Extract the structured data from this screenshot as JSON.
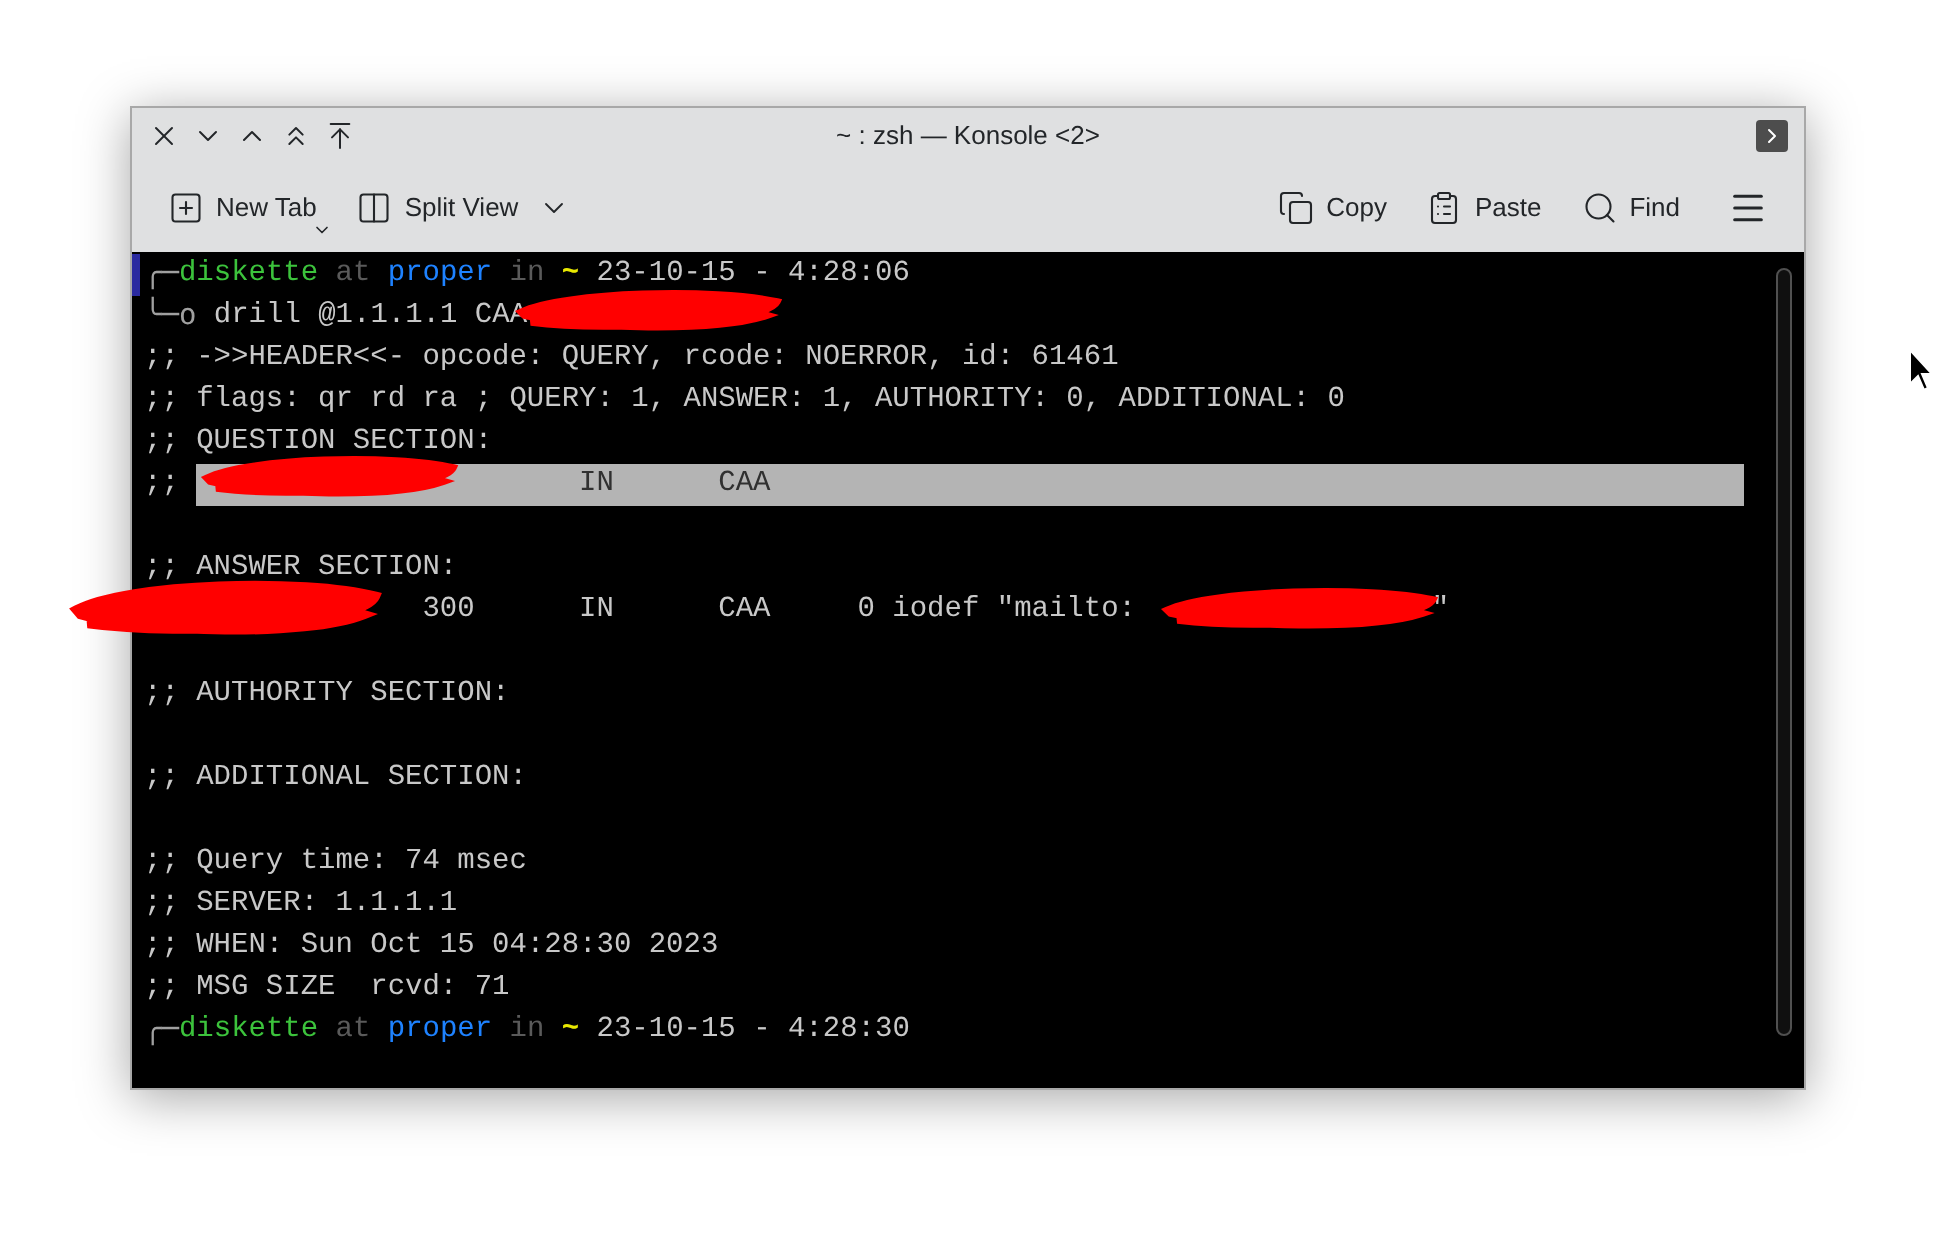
{
  "window": {
    "title": "~ : zsh — Konsole <2>"
  },
  "toolbar": {
    "left": [
      {
        "label": "New Tab",
        "kind": "newtab"
      },
      {
        "label": "Split View",
        "kind": "split"
      }
    ],
    "right": [
      {
        "label": "Copy",
        "kind": "copy"
      },
      {
        "label": "Paste",
        "kind": "paste"
      },
      {
        "label": "Find",
        "kind": "find"
      }
    ]
  },
  "terminal": {
    "lines": [
      {
        "kind": "prompt",
        "corner": "╭─",
        "user": "diskette",
        "at": "at",
        "host": "proper",
        "in": "in",
        "dir": "~",
        "time": "23-10-15 - 4:28:06",
        "active": true
      },
      {
        "kind": "command",
        "corner": "╰─o",
        "text": "drill @1.1.1.1 CAA"
      },
      {
        "kind": "output",
        "text": ";; ->>HEADER<<- opcode: QUERY, rcode: NOERROR, id: 61461"
      },
      {
        "kind": "output",
        "text": ";; flags: qr rd ra ; QUERY: 1, ANSWER: 1, AUTHORITY: 0, ADDITIONAL: 0"
      },
      {
        "kind": "output",
        "text": ";; QUESTION SECTION:"
      },
      {
        "kind": "question",
        "prefix": ";;",
        "fields": [
          "IN",
          "CAA"
        ],
        "highlighted": true
      },
      {
        "kind": "blank"
      },
      {
        "kind": "output",
        "text": ";; ANSWER SECTION:"
      },
      {
        "kind": "answer",
        "fields": [
          "300",
          "IN",
          "CAA",
          "0 iodef \"mailto:",
          "\""
        ]
      },
      {
        "kind": "blank"
      },
      {
        "kind": "output",
        "text": ";; AUTHORITY SECTION:"
      },
      {
        "kind": "blank"
      },
      {
        "kind": "output",
        "text": ";; ADDITIONAL SECTION:"
      },
      {
        "kind": "blank"
      },
      {
        "kind": "output",
        "text": ";; Query time: 74 msec"
      },
      {
        "kind": "output",
        "text": ";; SERVER: 1.1.1.1"
      },
      {
        "kind": "output",
        "text": ";; WHEN: Sun Oct 15 04:28:30 2023"
      },
      {
        "kind": "output",
        "text": ";; MSG SIZE  rcvd: 71"
      },
      {
        "kind": "prompt",
        "corner": "╭─",
        "user": "diskette",
        "at": "at",
        "host": "proper",
        "in": "in",
        "dir": "~",
        "time": "23-10-15 - 4:28:30",
        "active": false
      }
    ]
  }
}
